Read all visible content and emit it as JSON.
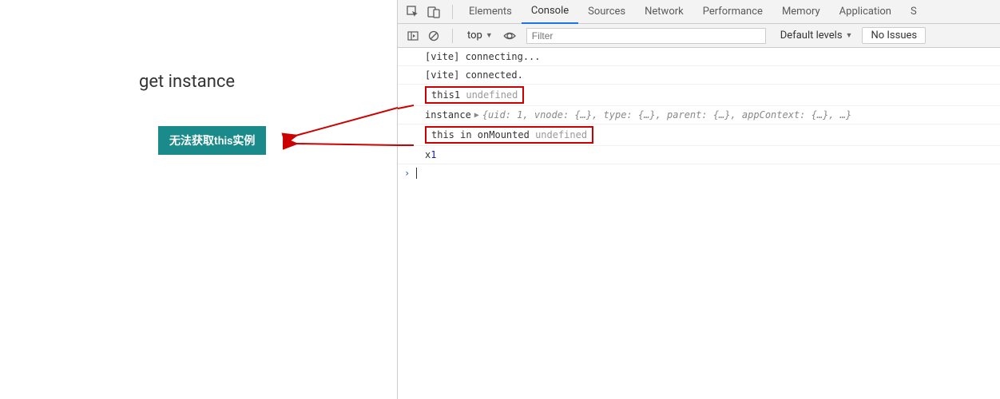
{
  "page": {
    "title": "get instance",
    "annotation": "无法获取this实例"
  },
  "devtools": {
    "tabs": [
      "Elements",
      "Console",
      "Sources",
      "Network",
      "Performance",
      "Memory",
      "Application",
      "S"
    ],
    "activeTab": "Console"
  },
  "toolbar": {
    "context": "top",
    "filterPlaceholder": "Filter",
    "levels": "Default levels",
    "issues": "No Issues"
  },
  "console": {
    "rows": [
      {
        "type": "text",
        "msg": "[vite] connecting..."
      },
      {
        "type": "text",
        "msg": "[vite] connected."
      },
      {
        "type": "undef",
        "msg": "this1",
        "val": "undefined",
        "boxed": true
      },
      {
        "type": "obj",
        "msg": "instance",
        "preview": "{uid: 1, vnode: {…}, type: {…}, parent: {…}, appContext: {…}, …}"
      },
      {
        "type": "undef",
        "msg": "this in onMounted",
        "val": "undefined",
        "boxed": true
      },
      {
        "type": "num",
        "msg": "x",
        "val": "1"
      }
    ]
  }
}
